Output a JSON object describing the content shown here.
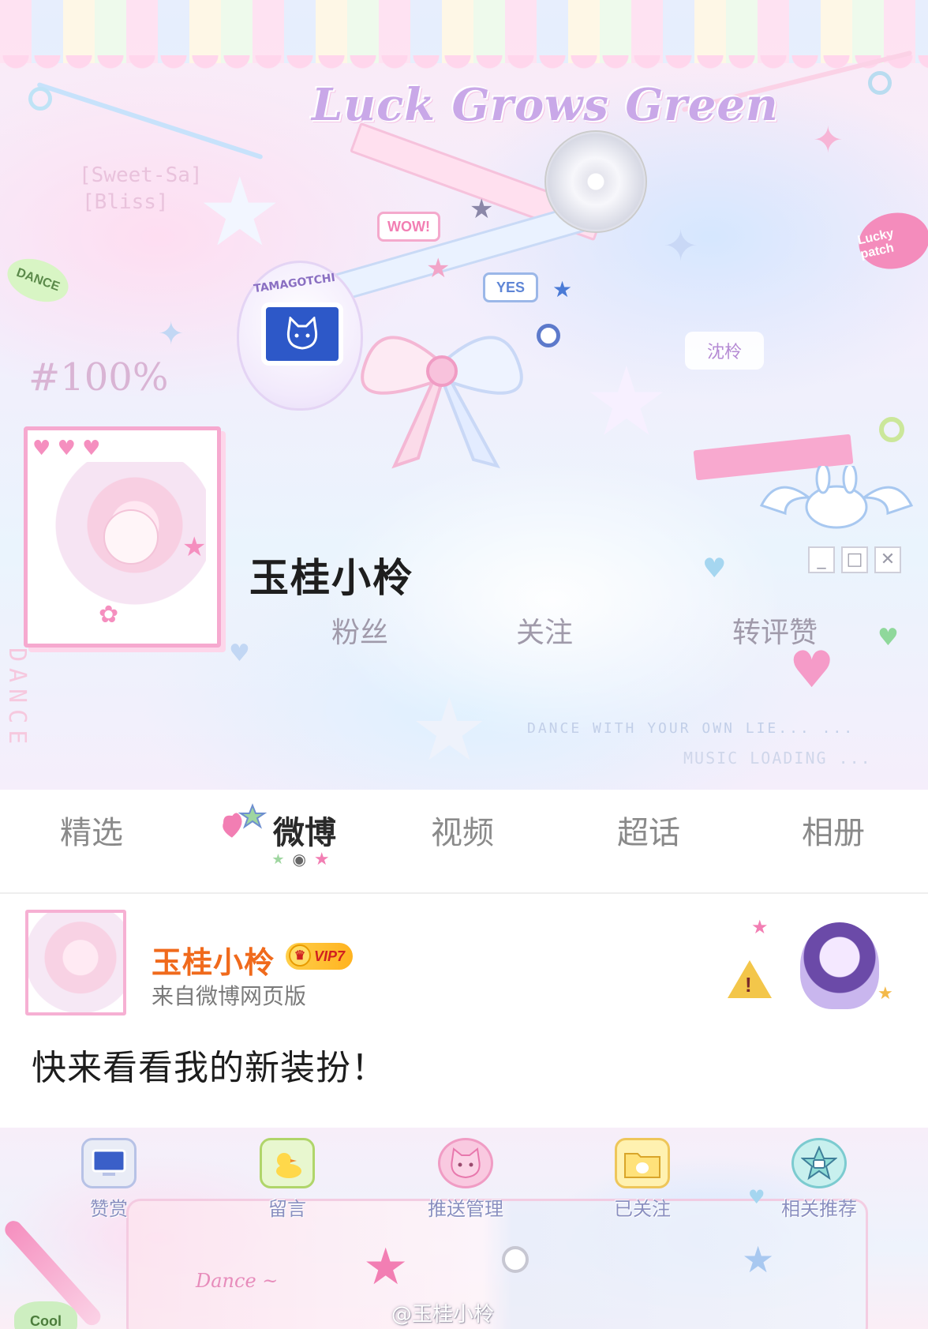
{
  "cover": {
    "title": "Luck Grows Green",
    "sweet_line1": "[Sweet-Sa]",
    "sweet_line2": "[Bliss]",
    "percent": "#100%",
    "sticker_wow": "WOW!",
    "sticker_yes": "YES",
    "sticker_dance": "DANCE",
    "sticker_lucky": "Lucky patch",
    "sticker_name": "沈柃",
    "tamagotchi_label": "TAMAGOTCHI",
    "tamagotchi_icon": "cat-face-icon",
    "marquee_1": "DANCE WITH YOUR OWN LIE... ...",
    "marquee_2": "MUSIC LOADING ...",
    "vertical_text": "DANCE"
  },
  "profile": {
    "name": "玉桂小柃",
    "stats": {
      "fans_label": "粉丝",
      "follow_label": "关注",
      "repost_label": "转评赞"
    },
    "window_buttons": {
      "minimize": "_",
      "maximize": "□",
      "close": "✕"
    }
  },
  "tabs": [
    {
      "label": "精选",
      "active": false
    },
    {
      "label": "微博",
      "active": true
    },
    {
      "label": "视频",
      "active": false
    },
    {
      "label": "超话",
      "active": false
    },
    {
      "label": "相册",
      "active": false
    }
  ],
  "post": {
    "author": "玉桂小柃",
    "vip_level": "VIP7",
    "source": "来自微博网页版",
    "text": "快来看看我的新装扮！"
  },
  "bottom_bar": {
    "items": [
      {
        "label": "赞赏",
        "icon": "computer-icon"
      },
      {
        "label": "留言",
        "icon": "duck-icon"
      },
      {
        "label": "推送管理",
        "icon": "cat-icon"
      },
      {
        "label": "已关注",
        "icon": "folder-bunny-icon"
      },
      {
        "label": "相关推荐",
        "icon": "star-robot-icon"
      }
    ],
    "deco_text": "Dance ~",
    "cool_badge": "Cool",
    "watermark": "@玉桂小柃"
  },
  "colors": {
    "accent_pink": "#f6a9cf",
    "name_orange": "#f06a1c",
    "vip_gold": "#ffb320",
    "tab_active": "#2a2a2a",
    "tab_inactive": "#8a8a8a"
  }
}
